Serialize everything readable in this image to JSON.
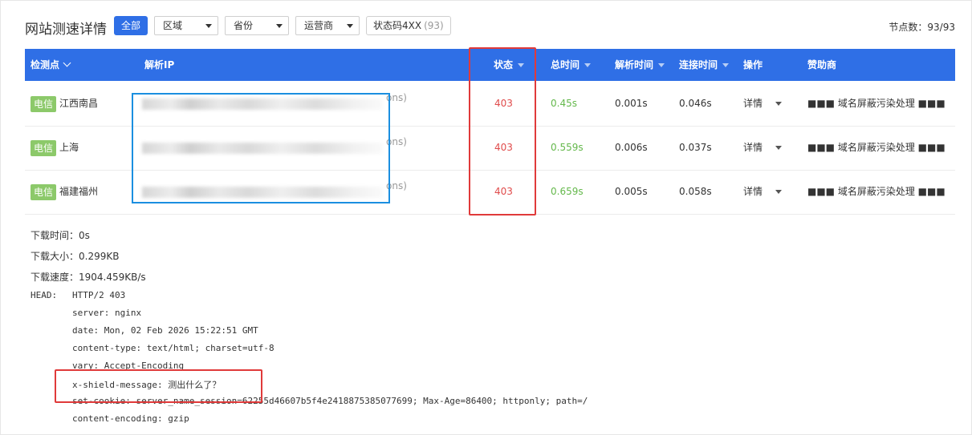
{
  "header": {
    "title": "网站测速详情",
    "all_button": "全部",
    "filters": [
      {
        "label": "区域"
      },
      {
        "label": "省份"
      },
      {
        "label": "运营商"
      }
    ],
    "status_filter": {
      "label": "状态码4XX",
      "count": "(93)"
    },
    "node_count": "节点数：93/93"
  },
  "table": {
    "columns": {
      "probe": "检测点",
      "ip": "解析IP",
      "status": "状态",
      "total_time": "总时间",
      "dns_time": "解析时间",
      "connect_time": "连接时间",
      "action": "操作",
      "sponsor": "赞助商"
    },
    "rows": [
      {
        "isp": "电信",
        "location": "江西南昌",
        "ip_suffix": "ons)",
        "status": "403",
        "total_time": "0.45s",
        "dns_time": "0.001s",
        "connect_time": "0.046s",
        "action": "详情",
        "sponsor": "■■■ 域名屏蔽污染处理 ■■■"
      },
      {
        "isp": "电信",
        "location": "上海",
        "ip_suffix": "ons)",
        "status": "403",
        "total_time": "0.559s",
        "dns_time": "0.006s",
        "connect_time": "0.037s",
        "action": "详情",
        "sponsor": "■■■ 域名屏蔽污染处理 ■■■"
      },
      {
        "isp": "电信",
        "location": "福建福州",
        "ip_suffix": "ons)",
        "status": "403",
        "total_time": "0.659s",
        "dns_time": "0.005s",
        "connect_time": "0.058s",
        "action": "详情",
        "sponsor": "■■■ 域名屏蔽污染处理 ■■■"
      }
    ]
  },
  "details": {
    "download_time": "下载时间：0s",
    "download_size": "下载大小：0.299KB",
    "download_speed": "下载速度：1904.459KB/s",
    "head_label": "HEAD:",
    "head_lines": [
      "HTTP/2 403",
      "server: nginx",
      "date: Mon, 02 Feb 2026 15:22:51 GMT",
      "content-type: text/html; charset=utf-8",
      "vary: Accept-Encoding",
      "x-shield-message: 测出什么了？",
      "set-cookie: server_name_session=62255d46607b5f4e2418875385077699; Max-Age=86400; httponly; path=/",
      "content-encoding: gzip"
    ]
  },
  "colors": {
    "accent": "#2f6fe6",
    "status_error": "#e04b4b",
    "time_good": "#64b84b",
    "isp_tag": "#8cc96a",
    "annotation_red": "#e03a3a",
    "annotation_blue": "#1b8fe0"
  }
}
